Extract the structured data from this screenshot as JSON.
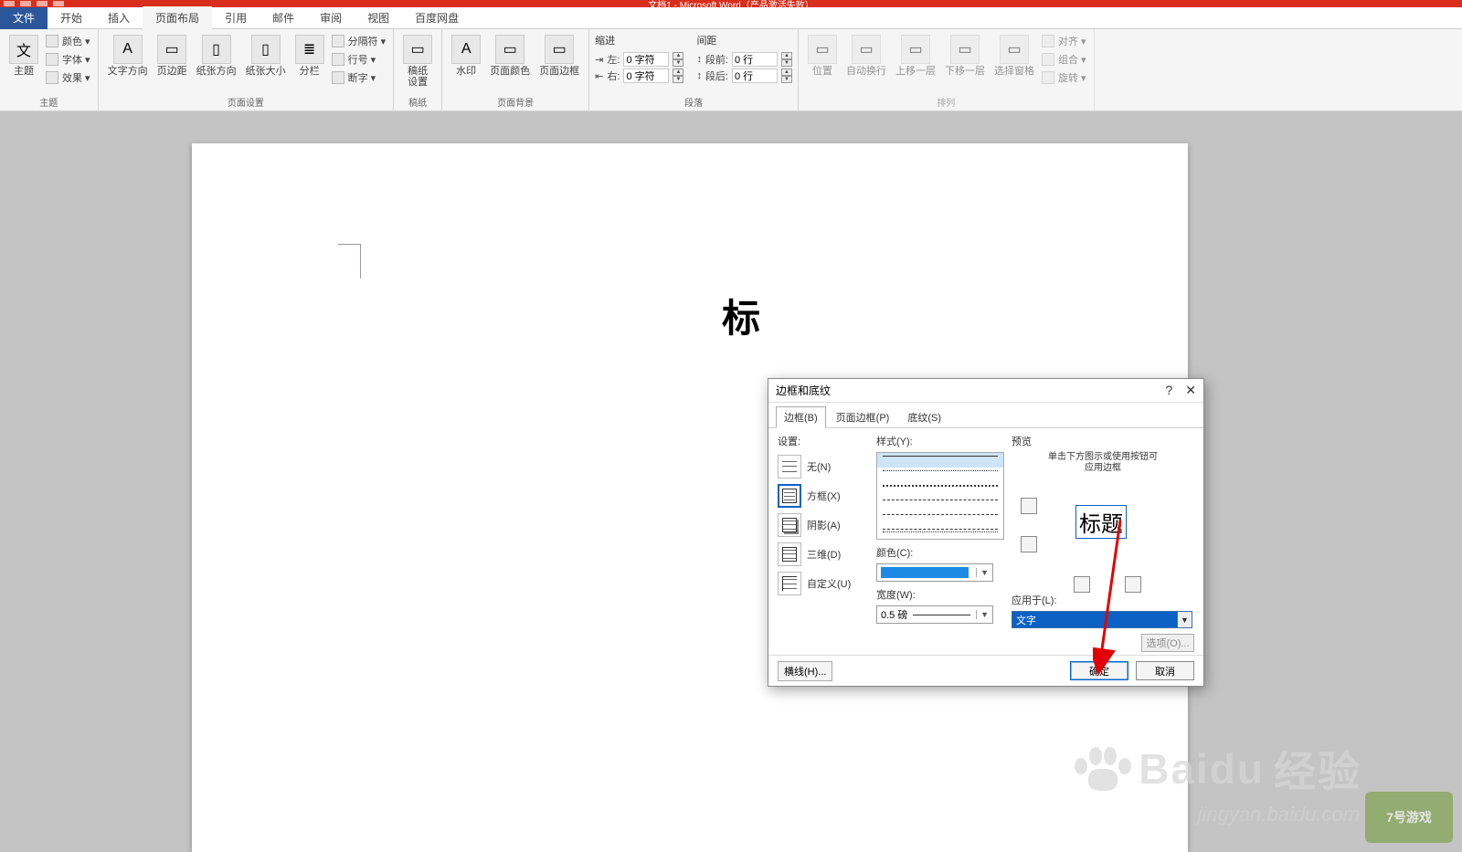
{
  "titlebar": {
    "text": "文档1 - Microsoft Word（产品激活失败）"
  },
  "tabs": {
    "file": "文件",
    "items": [
      "开始",
      "插入",
      "页面布局",
      "引用",
      "邮件",
      "审阅",
      "视图",
      "百度网盘"
    ],
    "active_index": 2
  },
  "ribbon": {
    "theme": {
      "label": "主题",
      "main": "主题",
      "color": "颜色 ▾",
      "font": "字体 ▾",
      "effect": "效果 ▾"
    },
    "page_setup": {
      "label": "页面设置",
      "text_dir": "文字方向",
      "margin": "页边距",
      "orient": "纸张方向",
      "size": "纸张大小",
      "columns": "分栏",
      "breaks": "分隔符 ▾",
      "line_no": "行号 ▾",
      "hyphen": "断字 ▾"
    },
    "paper": {
      "label": "稿纸",
      "btn": "稿纸\n设置"
    },
    "page_bg": {
      "label": "页面背景",
      "watermark": "水印",
      "color": "页面颜色",
      "border": "页面边框"
    },
    "paragraph": {
      "label": "段落",
      "indent_title": "缩进",
      "left": "左:",
      "left_val": "0 字符",
      "right": "右:",
      "right_val": "0 字符",
      "spacing_title": "间距",
      "before": "段前:",
      "before_val": "0 行",
      "after": "段后:",
      "after_val": "0 行"
    },
    "arrange": {
      "label": "排列",
      "position": "位置",
      "wrap": "自动换行",
      "forward": "上移一层",
      "backward": "下移一层",
      "pane": "选择窗格",
      "align": "对齐 ▾",
      "group": "组合 ▾",
      "rotate": "旋转 ▾"
    }
  },
  "document": {
    "title_text": "标"
  },
  "dialog": {
    "title": "边框和底纹",
    "help": "?",
    "tabs": {
      "border": "边框(B)",
      "page": "页面边框(P)",
      "shading": "底纹(S)",
      "active": 0
    },
    "setting": {
      "label": "设置:",
      "items": [
        "无(N)",
        "方框(X)",
        "阴影(A)",
        "三维(D)",
        "自定义(U)"
      ],
      "selected": 1
    },
    "style": {
      "label": "样式(Y):",
      "color_label": "颜色(C):",
      "width_label": "宽度(W):",
      "width_val": "0.5 磅"
    },
    "preview": {
      "label": "预览",
      "hint": "单击下方图示或使用按钮可\n应用边框",
      "sample": "标题",
      "apply_label": "应用于(L):",
      "apply_val": "文字",
      "options": "选项(O)..."
    },
    "footer": {
      "hline": "横线(H)...",
      "ok": "确定",
      "cancel": "取消"
    }
  },
  "watermark": {
    "brand": "Baidu",
    "brand_cn": "经验",
    "sub": "jingyan.baidu.com",
    "logo": "7号游戏"
  }
}
